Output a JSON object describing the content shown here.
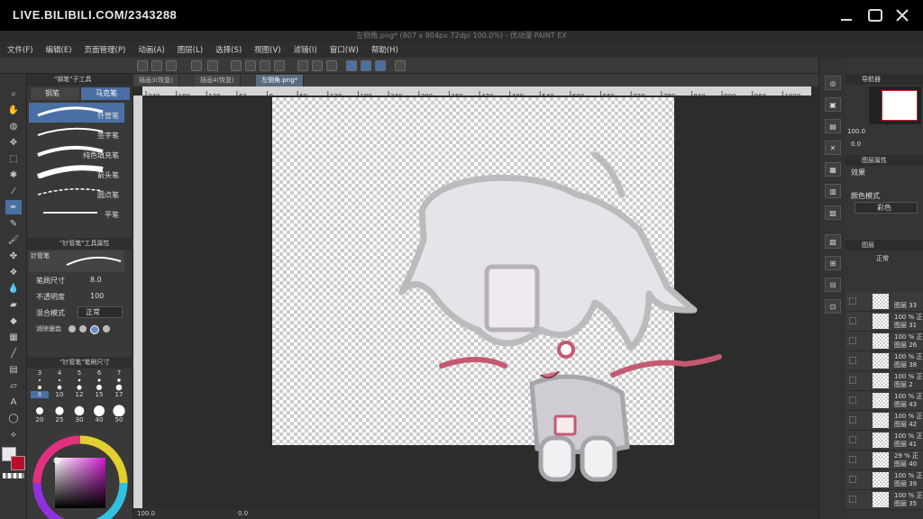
{
  "watermark": "LIVE.BILIBILI.COM/2343288",
  "app_title": "左侧角.png* (807 x 804px 72dpi 100.0%) - 优动漫 PAINT EX",
  "menu": [
    "文件(F)",
    "编辑(E)",
    "页面管理(P)",
    "动画(A)",
    "图层(L)",
    "选择(S)",
    "视图(V)",
    "滤镜(I)",
    "窗口(W)",
    "帮助(H)"
  ],
  "doc_tabs": [
    "插画3(恢复)",
    "插画4(恢复)",
    "左侧角.png*"
  ],
  "ruler_ticks": [
    "240",
    "180",
    "120",
    "60",
    "0",
    "60",
    "120",
    "180",
    "240",
    "300",
    "360",
    "420",
    "480",
    "540",
    "600",
    "660",
    "720",
    "780",
    "840",
    "900",
    "960",
    "1020"
  ],
  "tool_panel": {
    "header": "\"钢笔\"子工具",
    "tabs": [
      "钢笔",
      "马克笔"
    ],
    "brushes": [
      "针管笔",
      "签字笔",
      "纯色填充笔",
      "箭头笔",
      "圆点笔",
      "平笔"
    ]
  },
  "prop_panel": {
    "header": "\"针管笔\"工具属性",
    "preview_label": "针管笔",
    "brush_size_label": "笔刷尺寸",
    "brush_size_value": "8.0",
    "opacity_label": "不透明度",
    "opacity_value": "100",
    "blend_label": "混合模式",
    "blend_value": "正常",
    "aa_label": "消除锯齿"
  },
  "size_panel": {
    "header": "\"针管笔\"笔刷尺寸",
    "row1": [
      "3",
      "4",
      "5",
      "6",
      "7"
    ],
    "row2": [
      "8",
      "10",
      "12",
      "15",
      "17"
    ],
    "row3": [
      "20",
      "25",
      "30",
      "40",
      "50"
    ]
  },
  "status": {
    "zoom": "100.0",
    "angle": "0.0"
  },
  "navigator": {
    "header": "导航器",
    "zoom": "100.0",
    "angle": "0.0"
  },
  "layer_props": {
    "header": "图层属性",
    "effect_label": "效果",
    "color_mode_label": "颜色模式",
    "color_mode_value": "彩色"
  },
  "layers": {
    "header": "图层",
    "blend": "正常",
    "items": [
      {
        "pct": "",
        "mode": "",
        "name": "图层 33"
      },
      {
        "pct": "100 %",
        "mode": "正",
        "name": "图层 31"
      },
      {
        "pct": "100 %",
        "mode": "正",
        "name": "图层 26"
      },
      {
        "pct": "100 %",
        "mode": "正",
        "name": "图层 38"
      },
      {
        "pct": "100 %",
        "mode": "正",
        "name": "图层 2"
      },
      {
        "pct": "100 %",
        "mode": "正",
        "name": "图层 43"
      },
      {
        "pct": "100 %",
        "mode": "正",
        "name": "图层 42"
      },
      {
        "pct": "100 %",
        "mode": "正",
        "name": "图层 41"
      },
      {
        "pct": "29 %",
        "mode": "正",
        "name": "图层 40"
      },
      {
        "pct": "100 %",
        "mode": "正",
        "name": "图层 39"
      },
      {
        "pct": "100 %",
        "mode": "正",
        "name": "图层 35"
      }
    ]
  },
  "colors": {
    "accent": "#4a6fa5",
    "line": "#bcbabd",
    "pink": "#c45a72",
    "bg": "#2a2d2a"
  }
}
